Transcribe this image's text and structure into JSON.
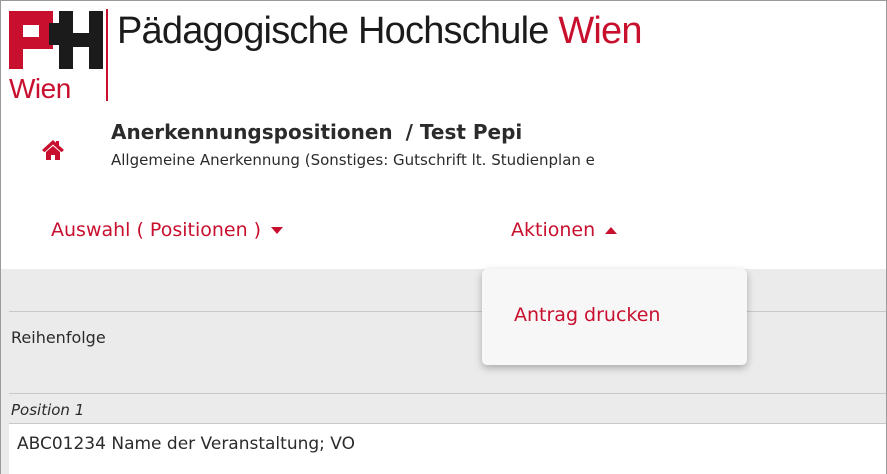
{
  "header": {
    "logo_word": "Wien",
    "title_main": "Pädagogische Hochschule",
    "title_accent": "Wien"
  },
  "page": {
    "title": "Anerkennungspositionen",
    "title_suffix": "/ Test Pepi",
    "subtitle": "Allgemeine Anerkennung (Sonstiges: Gutschrift lt. Studienplan e"
  },
  "menu": {
    "selection_label": "Auswahl ( Positionen )",
    "actions_label": "Aktionen"
  },
  "dropdown": {
    "items": [
      {
        "label": "Antrag drucken"
      }
    ]
  },
  "content": {
    "order_label": "Reihenfolge",
    "position_label": "Position 1",
    "course_label": "ABC01234 Name der Veranstaltung; VO"
  },
  "colors": {
    "accent": "#c8102e",
    "text": "#2b2b2b",
    "content_bg": "#ebebeb"
  },
  "icons": {
    "home": "home-icon",
    "selection_caret": "caret-down-icon",
    "actions_caret": "caret-up-icon"
  }
}
